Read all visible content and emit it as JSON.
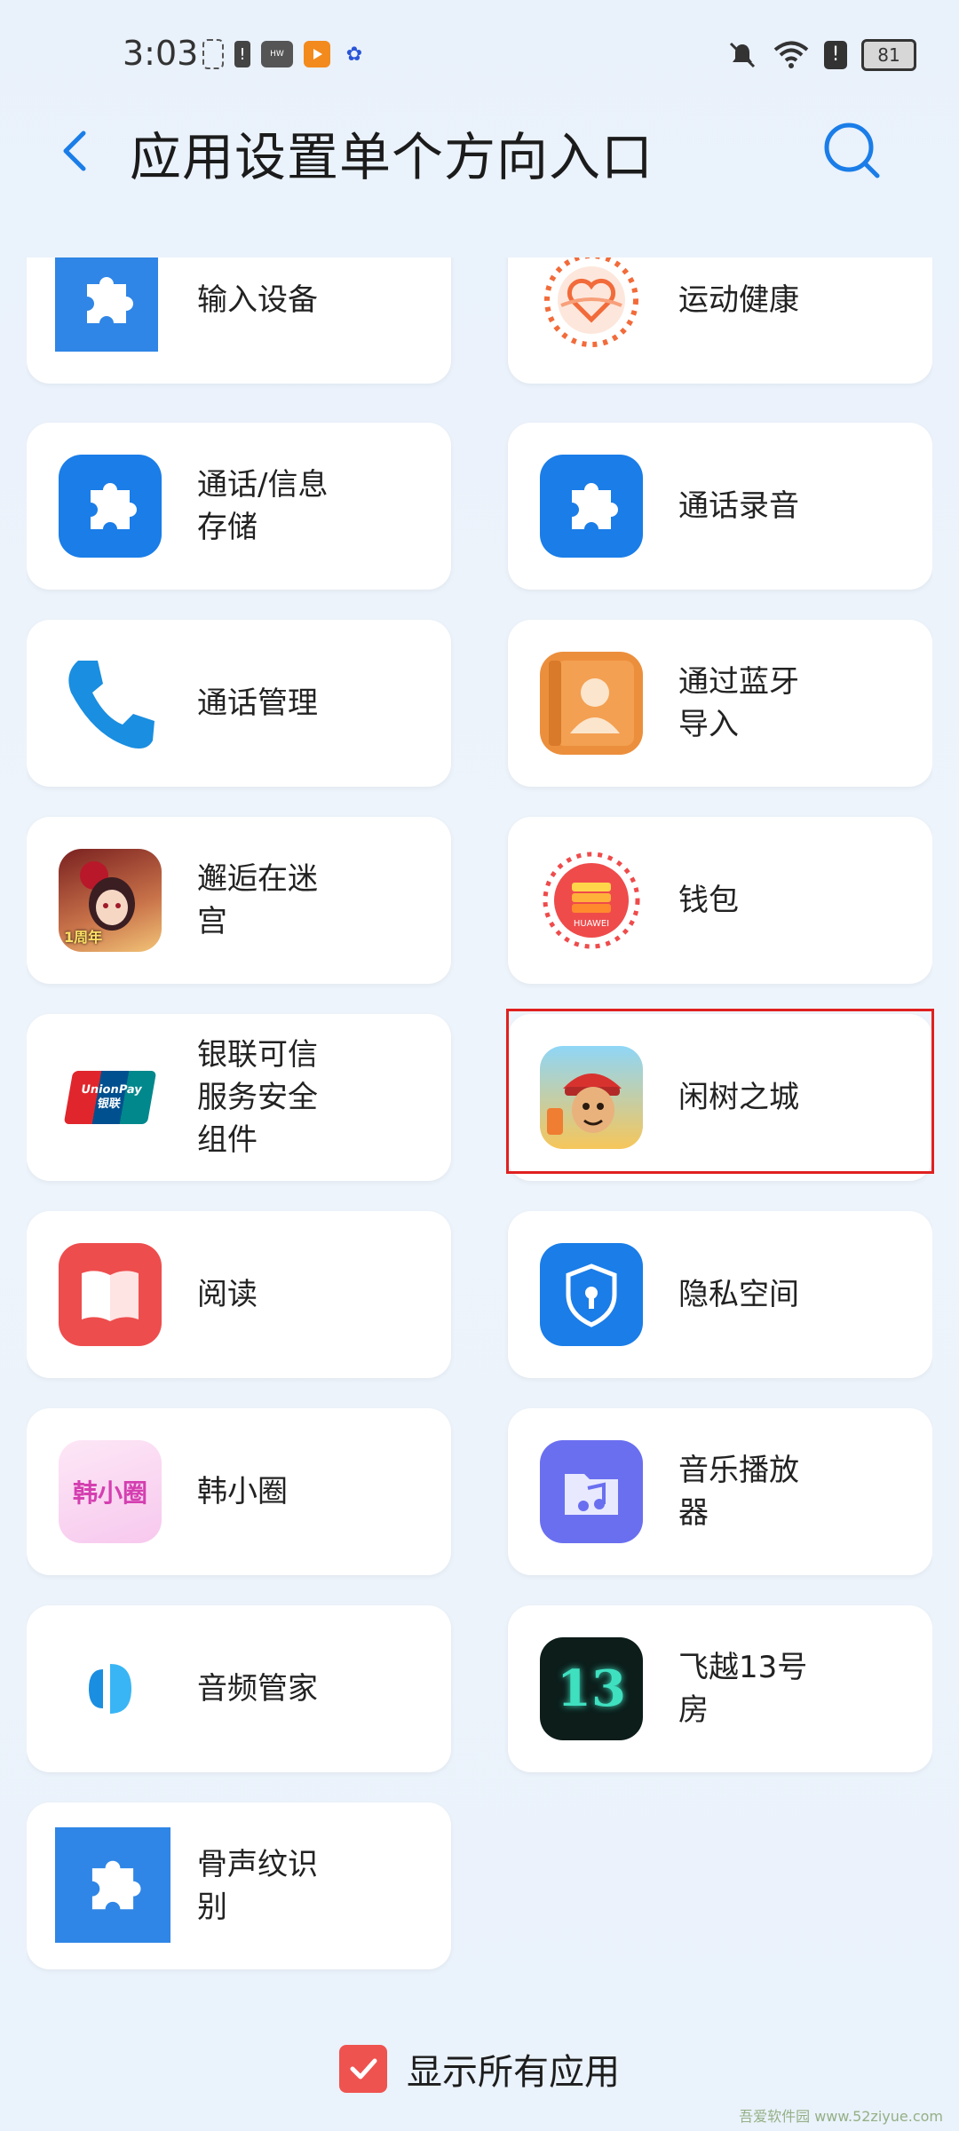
{
  "status_bar": {
    "time": "3:03",
    "battery": "81"
  },
  "header": {
    "title": "应用设置单个方向入口"
  },
  "apps": [
    {
      "label": "输入设备",
      "icon": "puzzle-icon"
    },
    {
      "label": "运动健康",
      "icon": "health-heart-icon"
    },
    {
      "label": "通话/信息\n存储",
      "icon": "puzzle-icon"
    },
    {
      "label": "通话录音",
      "icon": "puzzle-icon"
    },
    {
      "label": "通话管理",
      "icon": "phone-icon"
    },
    {
      "label": "通过蓝牙\n导入",
      "icon": "contacts-icon"
    },
    {
      "label": "邂逅在迷\n宫",
      "icon": "game-girl-icon",
      "badge": "1周年"
    },
    {
      "label": "钱包",
      "icon": "wallet-icon",
      "badge": "HUAWEI"
    },
    {
      "label": "银联可信\n服务安全\n组件",
      "icon": "unionpay-icon",
      "badge": "UnionPay 银联"
    },
    {
      "label": "闲树之城",
      "icon": "subway-surfers-icon"
    },
    {
      "label": "阅读",
      "icon": "book-icon"
    },
    {
      "label": "隐私空间",
      "icon": "privacy-shield-icon"
    },
    {
      "label": "韩小圈",
      "icon": "hanxiaoquan-icon",
      "badge": "韩小圈"
    },
    {
      "label": "音乐播放\n器",
      "icon": "music-folder-icon"
    },
    {
      "label": "音频管家",
      "icon": "audio-manager-icon"
    },
    {
      "label": "飞越13号\n房",
      "icon": "room13-icon",
      "badge": "13"
    },
    {
      "label": "骨声纹识\n别",
      "icon": "puzzle-icon"
    }
  ],
  "bottom": {
    "show_all_label": "显示所有应用",
    "checked": true
  },
  "watermark": "吾爱软件园 www.52ziyue.com",
  "colors": {
    "accent": "#1a7de8",
    "highlight": "#e02020",
    "checkbox": "#ef5350"
  }
}
